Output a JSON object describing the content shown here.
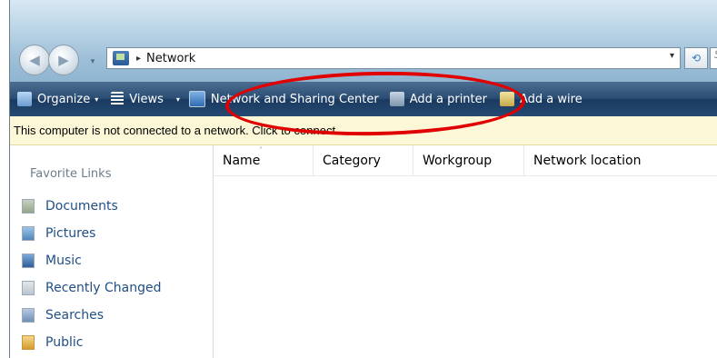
{
  "address": {
    "location": "Network",
    "separator": "▸",
    "dropdown": "▾",
    "search_placeholder": "S"
  },
  "nav": {
    "back_glyph": "◀",
    "forward_glyph": "▶",
    "dropdown_glyph": "▾",
    "refresh_glyph": "⟲"
  },
  "toolbar": {
    "organize_label": "Organize",
    "views_label": "Views",
    "network_center_label": "Network and Sharing Center",
    "add_printer_label": "Add a printer",
    "add_wireless_label": "Add a wire",
    "arrow": "▾"
  },
  "infobar": {
    "message": "This computer is not connected to a network. Click to connect..."
  },
  "sidebar": {
    "title": "Favorite Links",
    "items": [
      {
        "label": "Documents"
      },
      {
        "label": "Pictures"
      },
      {
        "label": "Music"
      },
      {
        "label": "Recently Changed"
      },
      {
        "label": "Searches"
      },
      {
        "label": "Public"
      }
    ]
  },
  "columns": {
    "name": "Name",
    "category": "Category",
    "workgroup": "Workgroup",
    "location": "Network location",
    "sort_indicator": "˄"
  },
  "colors": {
    "annotation": "#e00000",
    "toolbar": "#2c4d73",
    "infobar": "#fcf7d6",
    "link": "#1f4f86"
  }
}
